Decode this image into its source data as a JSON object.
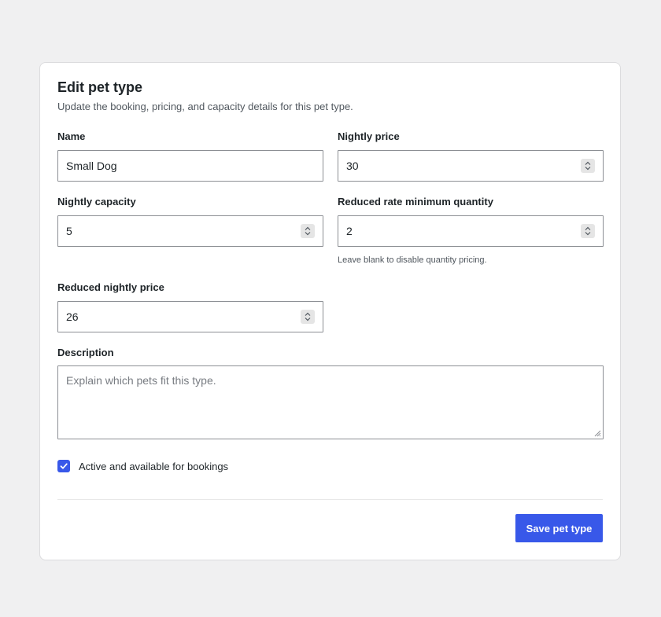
{
  "form": {
    "title": "Edit pet type",
    "subtitle": "Update the booking, pricing, and capacity details for this pet type.",
    "name": {
      "label": "Name",
      "value": "Small Dog"
    },
    "nightly_price": {
      "label": "Nightly price",
      "value": "30"
    },
    "nightly_capacity": {
      "label": "Nightly capacity",
      "value": "5"
    },
    "reduced_min_qty": {
      "label": "Reduced rate minimum quantity",
      "value": "2",
      "help": "Leave blank to disable quantity pricing."
    },
    "reduced_price": {
      "label": "Reduced nightly price",
      "value": "26"
    },
    "description": {
      "label": "Description",
      "value": "",
      "placeholder": "Explain which pets fit this type."
    },
    "active": {
      "label": "Active and available for bookings",
      "checked": true
    },
    "save_label": "Save pet type"
  },
  "colors": {
    "accent": "#3858e9",
    "page_bg": "#f0f0f1",
    "border": "#8c8f94"
  }
}
